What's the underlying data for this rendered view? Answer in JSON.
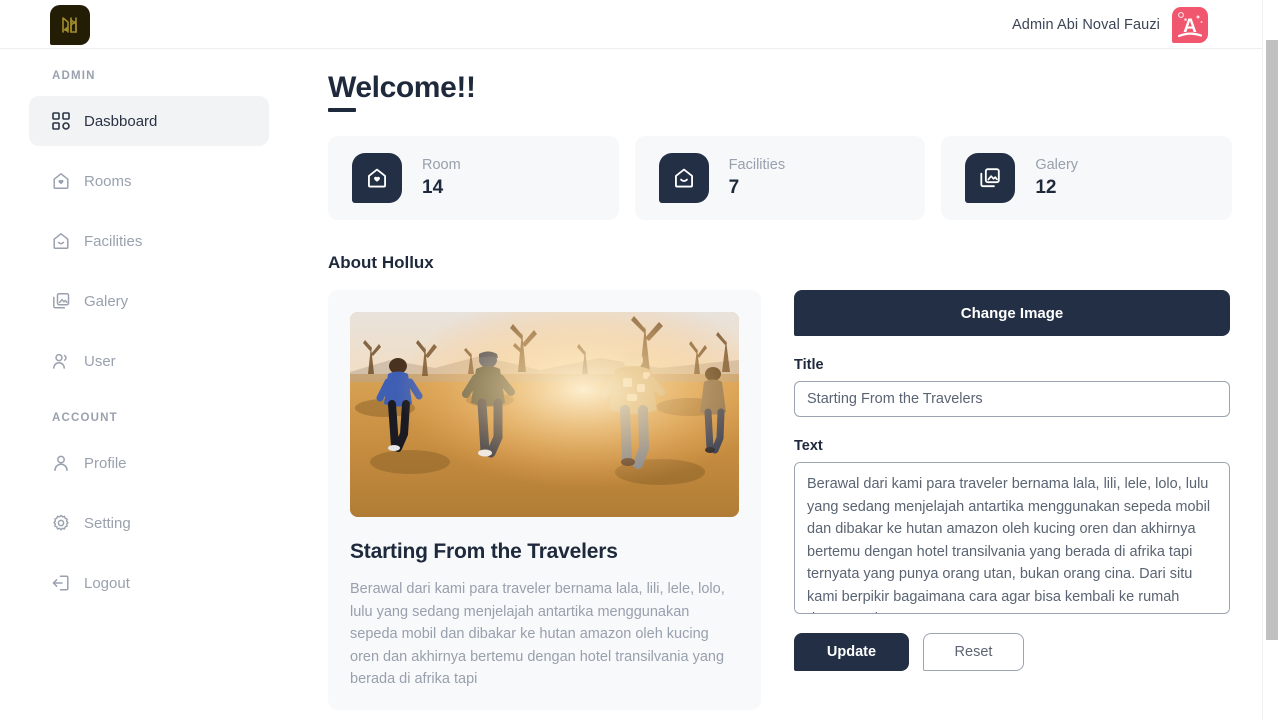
{
  "header": {
    "logo_icon": "hollux-logo-icon",
    "admin_name": "Admin Abi Noval Fauzi",
    "avatar_letter": "A"
  },
  "sidebar": {
    "sections": [
      {
        "label": "ADMIN",
        "items": [
          {
            "label": "Dasbboard",
            "icon": "grid-icon",
            "active": true
          },
          {
            "label": "Rooms",
            "icon": "home-heart-icon",
            "active": false
          },
          {
            "label": "Facilities",
            "icon": "home-smile-icon",
            "active": false
          },
          {
            "label": "Galery",
            "icon": "images-icon",
            "active": false
          },
          {
            "label": "User",
            "icon": "users-icon",
            "active": false
          }
        ]
      },
      {
        "label": "ACCOUNT",
        "items": [
          {
            "label": "Profile",
            "icon": "user-icon",
            "active": false
          },
          {
            "label": "Setting",
            "icon": "gear-icon",
            "active": false
          },
          {
            "label": "Logout",
            "icon": "logout-icon",
            "active": false
          }
        ]
      }
    ]
  },
  "main": {
    "page_title": "Welcome!!",
    "stats": [
      {
        "label": "Room",
        "value": "14",
        "icon": "home-heart-icon"
      },
      {
        "label": "Facilities",
        "value": "7",
        "icon": "home-smile-icon"
      },
      {
        "label": "Galery",
        "value": "12",
        "icon": "images-icon"
      }
    ],
    "about_heading": "About Hollux",
    "preview": {
      "image_alt": "group-of-travelers-running-at-sunset",
      "heading": "Starting From the Travelers",
      "body": "Berawal dari kami para traveler bernama lala, lili, lele, lolo, lulu yang sedang menjelajah antartika menggunakan sepeda mobil dan dibakar ke hutan amazon oleh kucing oren dan akhirnya bertemu dengan hotel transilvania yang berada di afrika tapi"
    },
    "form": {
      "change_image_label": "Change Image",
      "title_label": "Title",
      "title_value": "Starting From the Travelers",
      "text_label": "Text",
      "text_value": "Berawal dari kami para traveler bernama lala, lili, lele, lolo, lulu yang sedang menjelajah antartika menggunakan sepeda mobil dan dibakar ke hutan amazon oleh kucing oren dan akhirnya bertemu dengan hotel transilvania yang berada di afrika tapi ternyata yang punya orang utan, bukan orang cina. Dari situ kami berpikir bagaimana cara agar bisa kembali ke rumah dengan selamat",
      "update_label": "Update",
      "reset_label": "Reset"
    }
  },
  "colors": {
    "dark": "#232f44",
    "muted": "#98a0ad",
    "card_bg": "#f7f8fa",
    "avatar": "#f0566e",
    "logo_bg": "#241d06"
  }
}
